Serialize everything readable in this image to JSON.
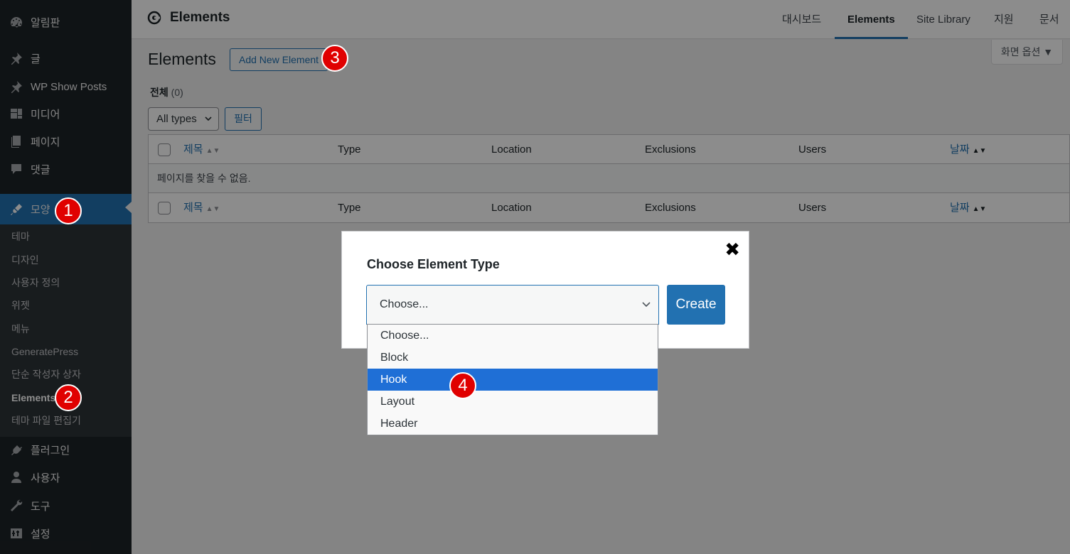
{
  "sidebar": {
    "menu": [
      {
        "label": "알림판",
        "icon": "dashboard-icon"
      },
      {
        "label": "글",
        "icon": "pin-icon"
      },
      {
        "label": "WP Show Posts",
        "icon": "pin-icon"
      },
      {
        "label": "미디어",
        "icon": "media-icon"
      },
      {
        "label": "페이지",
        "icon": "page-icon"
      },
      {
        "label": "댓글",
        "icon": "comment-icon"
      },
      {
        "label": "모양",
        "icon": "appearance-icon"
      }
    ],
    "submenu": [
      "테마",
      "디자인",
      "사용자 정의",
      "위젯",
      "메뉴",
      "GeneratePress",
      "단순 작성자 상자",
      "Elements",
      "테마 파일 편집기"
    ],
    "bottom_menu": [
      {
        "label": "플러그인",
        "icon": "plugin-icon"
      },
      {
        "label": "사용자",
        "icon": "user-icon"
      },
      {
        "label": "도구",
        "icon": "wrench-icon"
      },
      {
        "label": "설정",
        "icon": "settings-icon"
      }
    ]
  },
  "topbar": {
    "brand": "Elements",
    "tabs": [
      "대시보드",
      "Elements",
      "Site Library",
      "지원",
      "문서"
    ],
    "active_tab": "Elements"
  },
  "screen_options": "화면 옵션 ▼",
  "page": {
    "title": "Elements",
    "add_new": "Add New Element",
    "filter_all": "전체",
    "filter_count": "(0)",
    "type_select": "All types",
    "filter_button": "필터",
    "columns": [
      "제목",
      "Type",
      "Location",
      "Exclusions",
      "Users",
      "날짜"
    ],
    "empty_message": "페이지를 찾을 수 없음."
  },
  "modal": {
    "title": "Choose Element Type",
    "close": "✖",
    "select_value": "Choose...",
    "create": "Create",
    "options": [
      "Choose...",
      "Block",
      "Hook",
      "Layout",
      "Header"
    ],
    "selected_option": "Hook"
  },
  "markers": [
    "1",
    "2",
    "3",
    "4"
  ],
  "colors": {
    "accent": "#2271b1",
    "sidebar_bg": "#1d2327",
    "marker": "#e00000",
    "highlight": "#1f6fd6"
  }
}
